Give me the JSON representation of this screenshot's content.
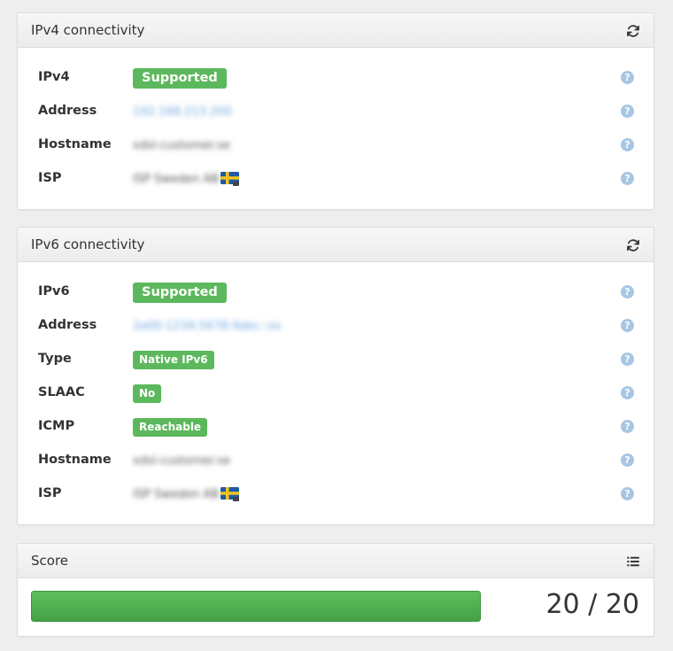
{
  "ipv4_panel": {
    "title": "IPv4 connectivity",
    "header_icon": "refresh-icon",
    "rows": [
      {
        "label": "IPv4",
        "value": "Supported",
        "kind": "badge"
      },
      {
        "label": "Address",
        "value": "192.168.213.200",
        "kind": "blur-link"
      },
      {
        "label": "Hostname",
        "value": "xdsl-customer.se",
        "kind": "blur"
      },
      {
        "label": "ISP",
        "value": "ISP Sweden AB",
        "kind": "blur-flag"
      }
    ]
  },
  "ipv6_panel": {
    "title": "IPv6 connectivity",
    "header_icon": "refresh-icon",
    "rows": [
      {
        "label": "IPv6",
        "value": "Supported",
        "kind": "badge"
      },
      {
        "label": "Address",
        "value": "2a00:1234:5678:9abc::xx",
        "kind": "blur-link"
      },
      {
        "label": "Type",
        "value": "Native IPv6",
        "kind": "badge-sm"
      },
      {
        "label": "SLAAC",
        "value": "No",
        "kind": "badge-sm"
      },
      {
        "label": "ICMP",
        "value": "Reachable",
        "kind": "badge-sm"
      },
      {
        "label": "Hostname",
        "value": "xdsl-customer.se",
        "kind": "blur"
      },
      {
        "label": "ISP",
        "value": "ISP Sweden AB",
        "kind": "blur-flag"
      }
    ]
  },
  "score_panel": {
    "title": "Score",
    "header_icon": "list-icon",
    "score_text": "20 / 20",
    "progress_fraction": 1.0
  },
  "colors": {
    "success_green": "#5cb85c",
    "help_icon_blue": "#a8c6e4",
    "link_blue": "#6aa6e0"
  },
  "icons": {
    "help": "question-circle-icon",
    "flag": "sweden-flag-icon"
  }
}
